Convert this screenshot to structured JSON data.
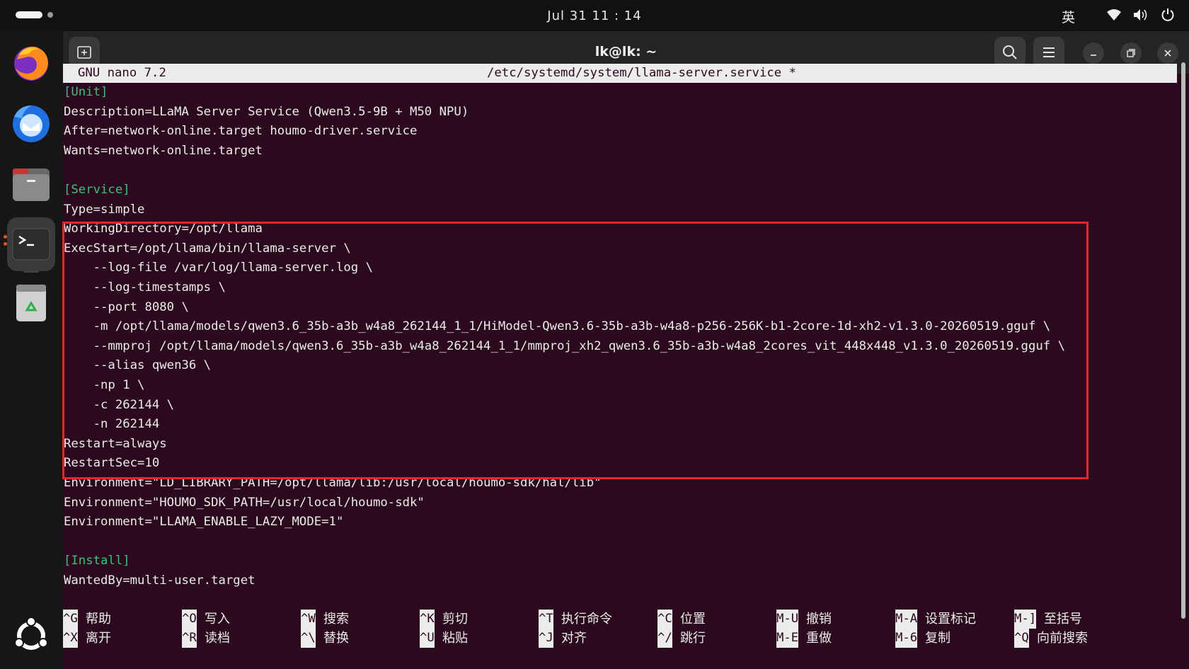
{
  "top_bar": {
    "clock": "Jul 31  11 : 14",
    "input_method": "英"
  },
  "dock": {
    "items": [
      "firefox",
      "thunderbird",
      "files",
      "terminal",
      "trash",
      "apps-grid"
    ]
  },
  "window": {
    "title": "lk@lk: ~"
  },
  "nano": {
    "version": "GNU nano 7.2",
    "filename": "/etc/systemd/system/llama-server.service *",
    "lines": [
      {
        "text": "[Unit]",
        "section": true
      },
      {
        "text": "Description=LLaMA Server Service (Qwen3.5-9B + M50 NPU)"
      },
      {
        "text": "After=network-online.target houmo-driver.service"
      },
      {
        "text": "Wants=network-online.target"
      },
      {
        "text": ""
      },
      {
        "text": "[Service]",
        "section": true
      },
      {
        "text": "Type=simple"
      },
      {
        "text": "WorkingDirectory=/opt/llama"
      },
      {
        "text": "ExecStart=/opt/llama/bin/llama-server \\"
      },
      {
        "text": "    --log-file /var/log/llama-server.log \\"
      },
      {
        "text": "    --log-timestamps \\"
      },
      {
        "text": "    --port 8080 \\"
      },
      {
        "text": "    -m /opt/llama/models/qwen3.6_35b-a3b_w4a8_262144_1_1/HiModel-Qwen3.6-35b-a3b-w4a8-p256-256K-b1-2core-1d-xh2-v1.3.0-20260519.gguf \\"
      },
      {
        "text": "    --mmproj /opt/llama/models/qwen3.6_35b-a3b_w4a8_262144_1_1/mmproj_xh2_qwen3.6_35b-a3b-w4a8_2cores_vit_448x448_v1.3.0_20260519.gguf \\"
      },
      {
        "text": "    --alias qwen36 \\"
      },
      {
        "text": "    -np 1 \\"
      },
      {
        "text": "    -c 262144 \\"
      },
      {
        "text": "    -n 262144"
      },
      {
        "text": "Restart=always"
      },
      {
        "text": "RestartSec=10"
      },
      {
        "text": "Environment=\"LD_LIBRARY_PATH=/opt/llama/lib:/usr/local/houmo-sdk/hal/lib\""
      },
      {
        "text": "Environment=\"HOUMO_SDK_PATH=/usr/local/houmo-sdk\""
      },
      {
        "text": "Environment=\"LLAMA_ENABLE_LAZY_MODE=1\""
      },
      {
        "text": ""
      },
      {
        "text": "[Install]",
        "section": true
      },
      {
        "text": "WantedBy=multi-user.target"
      }
    ],
    "shortcuts_row1": [
      {
        "key": "^G",
        "label": "帮助"
      },
      {
        "key": "^O",
        "label": "写入"
      },
      {
        "key": "^W",
        "label": "搜索"
      },
      {
        "key": "^K",
        "label": "剪切"
      },
      {
        "key": "^T",
        "label": "执行命令"
      },
      {
        "key": "^C",
        "label": "位置"
      },
      {
        "key": "M-U",
        "label": "撤销"
      },
      {
        "key": "M-A",
        "label": "设置标记"
      },
      {
        "key": "M-]",
        "label": "至括号"
      }
    ],
    "shortcuts_row2": [
      {
        "key": "^X",
        "label": "离开"
      },
      {
        "key": "^R",
        "label": "读档"
      },
      {
        "key": "^\\",
        "label": "替换"
      },
      {
        "key": "^U",
        "label": "粘贴"
      },
      {
        "key": "^J",
        "label": "对齐"
      },
      {
        "key": "^/",
        "label": "跳行"
      },
      {
        "key": "M-E",
        "label": "重做"
      },
      {
        "key": "M-6",
        "label": "复制"
      },
      {
        "key": "^Q",
        "label": "向前搜索"
      }
    ]
  }
}
